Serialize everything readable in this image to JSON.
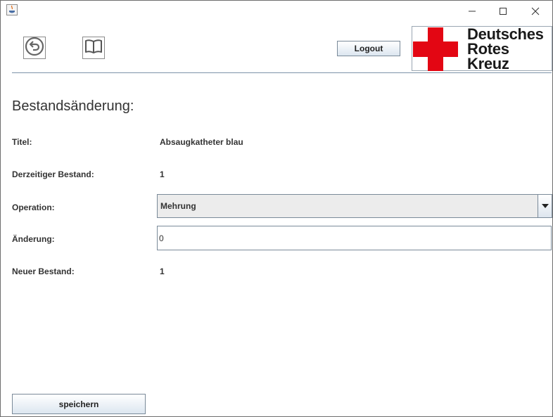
{
  "window": {
    "controls": {
      "minimize": "minimize-icon",
      "maximize": "maximize-icon",
      "close": "close-icon"
    }
  },
  "toolbar": {
    "back_icon": "back-arrow-icon",
    "book_icon": "book-icon",
    "logout_label": "Logout"
  },
  "logo": {
    "lines": [
      "Deutsches",
      "Rotes",
      "Kreuz"
    ],
    "cross_color": "#e30613"
  },
  "page": {
    "title": "Bestandsänderung:"
  },
  "form": {
    "title_label": "Titel:",
    "title_value": "Absaugkatheter blau",
    "current_label": "Derzeitiger Bestand:",
    "current_value": "1",
    "operation_label": "Operation:",
    "operation_value": "Mehrung",
    "change_label": "Änderung:",
    "change_value": "0",
    "new_label": "Neuer Bestand:",
    "new_value": "1"
  },
  "actions": {
    "save_label": "speichern"
  }
}
